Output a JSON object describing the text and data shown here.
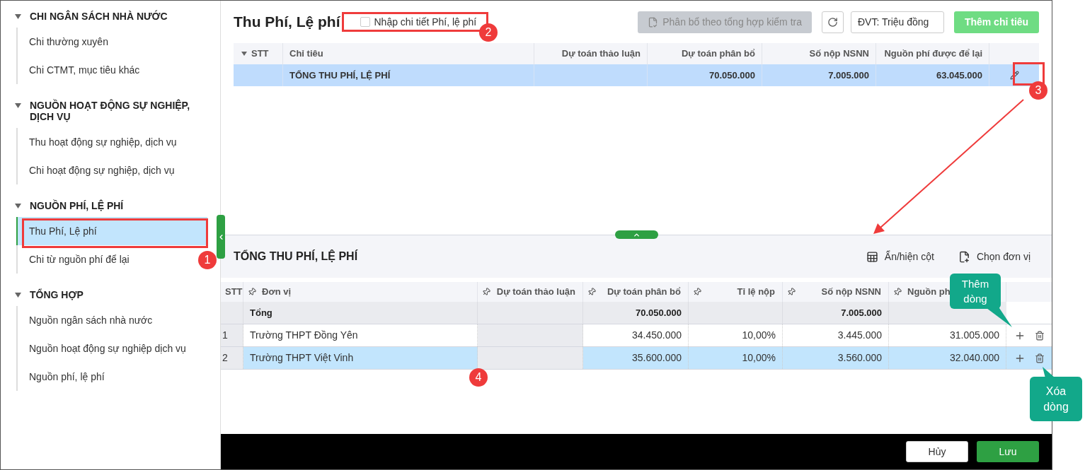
{
  "sidebar": {
    "groups": [
      {
        "title": "CHI NGÂN SÁCH NHÀ NƯỚC",
        "expanded": true,
        "items": [
          {
            "label": "Chi thường xuyên",
            "selected": false
          },
          {
            "label": "Chi CTMT, mục tiêu khác",
            "selected": false
          }
        ]
      },
      {
        "title": "NGUỒN HOẠT ĐỘNG SỰ NGHIỆP, DỊCH VỤ",
        "expanded": true,
        "items": [
          {
            "label": "Thu hoạt động sự nghiệp, dịch vụ",
            "selected": false
          },
          {
            "label": "Chi hoạt động sự nghiệp, dịch vụ",
            "selected": false
          }
        ]
      },
      {
        "title": "NGUỒN PHÍ, LỆ PHÍ",
        "expanded": true,
        "items": [
          {
            "label": "Thu Phí, Lệ phí",
            "selected": true
          },
          {
            "label": "Chi từ nguồn phí để lại",
            "selected": false
          }
        ]
      },
      {
        "title": "TỔNG HỢP",
        "expanded": true,
        "items": [
          {
            "label": "Nguồn ngân sách nhà nước",
            "selected": false
          },
          {
            "label": "Nguồn hoạt động sự nghiệp dịch vụ",
            "selected": false
          },
          {
            "label": "Nguồn phí, lệ phí",
            "selected": false
          }
        ]
      }
    ]
  },
  "page_title": "Thu Phí, Lệ phí",
  "detail_checkbox": {
    "label": "Nhập chi tiết Phí, lệ phí",
    "checked": false
  },
  "allocate_button": {
    "label": "Phân bổ theo tổng hợp kiểm tra",
    "disabled": true
  },
  "unit_field": {
    "value": "ĐVT: Triệu đồng"
  },
  "add_button": {
    "label": "Thêm chỉ tiêu",
    "disabled": true
  },
  "top_table": {
    "columns": [
      "STT",
      "Chỉ tiêu",
      "Dự toán thảo luận",
      "Dự toán phân bổ",
      "Số nộp NSNN",
      "Nguồn phí được để lại"
    ],
    "rows": [
      {
        "cells": [
          null,
          "TỔNG THU PHÍ, LỆ PHÍ",
          null,
          "70.050.000",
          "7.005.000",
          "63.045.000"
        ],
        "selected": true
      }
    ]
  },
  "detail": {
    "title": "TỔNG THU PHÍ, LỆ PHÍ",
    "tools": [
      "Ẩn/hiện cột",
      "Chọn đơn vị"
    ],
    "columns": [
      {
        "label": "STT",
        "pinned": false
      },
      {
        "label": "Đơn vị",
        "pinned": true
      },
      {
        "label": "Dự toán thảo luận",
        "pinned": true
      },
      {
        "label": "Dự toán phân bổ",
        "pinned": true
      },
      {
        "label": "Tỉ lệ nộp",
        "pinned": true
      },
      {
        "label": "Số nộp NSNN",
        "pinned": true
      },
      {
        "label": "Nguồn ph",
        "pinned": true
      }
    ],
    "total_row": {
      "label": "Tổng",
      "du_toan_phan_bo": "70.050.000",
      "so_nop_nsnn": "7.005.000"
    },
    "rows": [
      {
        "cells": [
          "1",
          "Trường THPT Đồng Yên",
          null,
          "34.450.000",
          "10,00%",
          "3.445.000",
          "31.005.000"
        ],
        "selected": false
      },
      {
        "cells": [
          "2",
          "Trường THPT Việt Vinh",
          null,
          "35.600.000",
          "10,00%",
          "3.560.000",
          "32.040.000"
        ],
        "selected": true
      }
    ]
  },
  "footer_buttons": [
    {
      "label": "Hủy",
      "kind": "secondary"
    },
    {
      "label": "Lưu",
      "kind": "primary"
    }
  ],
  "callouts": [
    "1",
    "2",
    "3",
    "4"
  ],
  "tooltips": [
    "Thêm dòng",
    "Xóa dòng"
  ]
}
